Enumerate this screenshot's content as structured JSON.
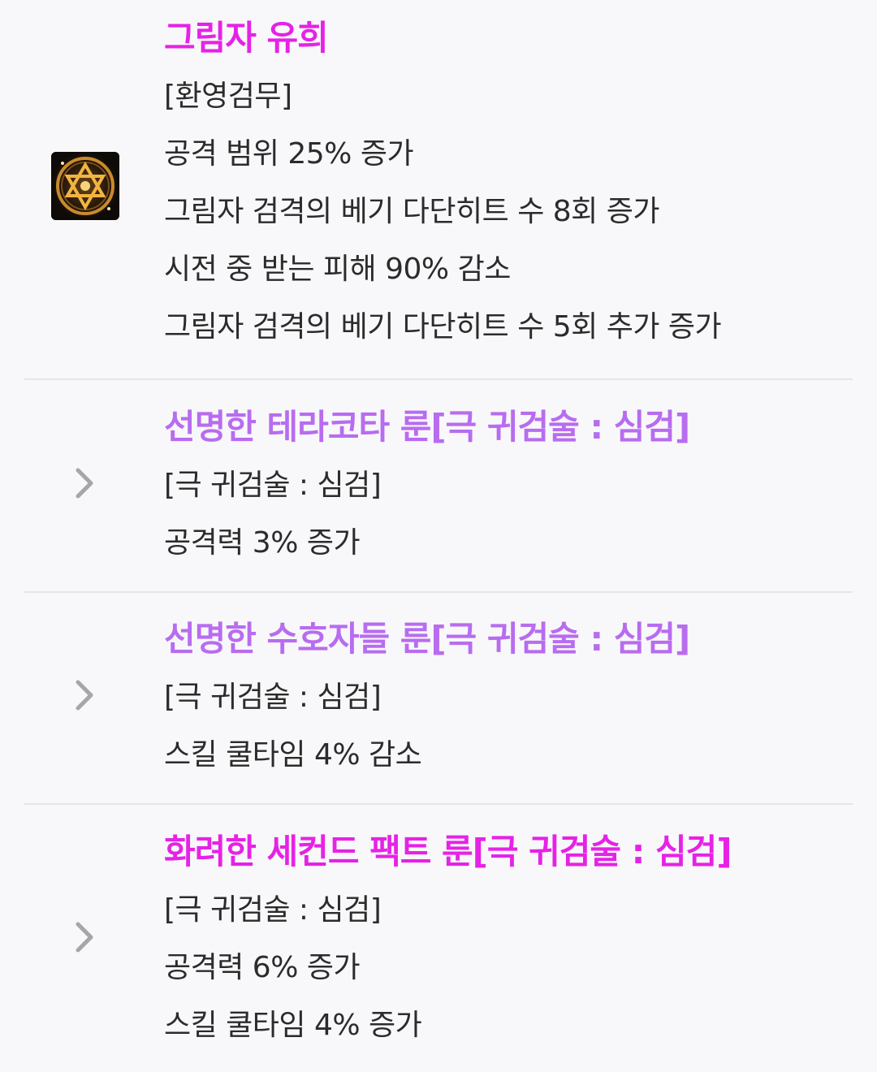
{
  "colors": {
    "title_magenta": "#e622e6",
    "title_violet": "#b86cf0",
    "text": "#2b2b2b",
    "divider": "#e4e4ea",
    "chevron": "#a6a6a6"
  },
  "skill": {
    "icon": "hexagram-rune-icon",
    "title": "그림자 유희",
    "lines": [
      "[환영검무]",
      "공격 범위 25% 증가",
      "그림자 검격의 베기 다단히트 수 8회 증가",
      "시전 중 받는 피해 90% 감소",
      "그림자 검격의 베기 다단히트 수 5회 추가 증가"
    ]
  },
  "runes": [
    {
      "icon": "chevron-right-icon",
      "title": "선명한 테라코타 룬[극 귀검술 : 심검]",
      "lines": [
        "[극 귀검술 : 심검]",
        "공격력 3% 증가"
      ]
    },
    {
      "icon": "chevron-right-icon",
      "title": "선명한 수호자들 룬[극 귀검술 : 심검]",
      "lines": [
        "[극 귀검술 : 심검]",
        "스킬 쿨타임 4% 감소"
      ]
    },
    {
      "icon": "chevron-right-icon",
      "title": "화려한 세컨드 팩트 룬[극 귀검술 : 심검]",
      "lines": [
        "[극 귀검술 : 심검]",
        "공격력 6% 증가",
        "스킬 쿨타임 4% 증가"
      ]
    }
  ]
}
